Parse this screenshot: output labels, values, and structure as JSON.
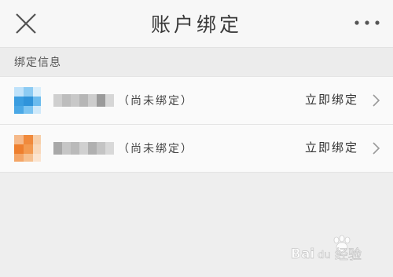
{
  "navbar": {
    "title": "账户绑定",
    "close_icon": "close-icon",
    "more_icon": "more-horizontal-icon"
  },
  "section": {
    "label": "绑定信息"
  },
  "accounts": [
    {
      "status": "（尚未绑定）",
      "action": "立即绑定",
      "icon": "app-icon-blue",
      "accent": "#3a9de0"
    },
    {
      "status": "（尚未绑定）",
      "action": "立即绑定",
      "icon": "app-icon-orange",
      "accent": "#f08a3c"
    }
  ],
  "watermark": {
    "text": "Bai 经验",
    "icon": "baidu-paw-icon"
  }
}
